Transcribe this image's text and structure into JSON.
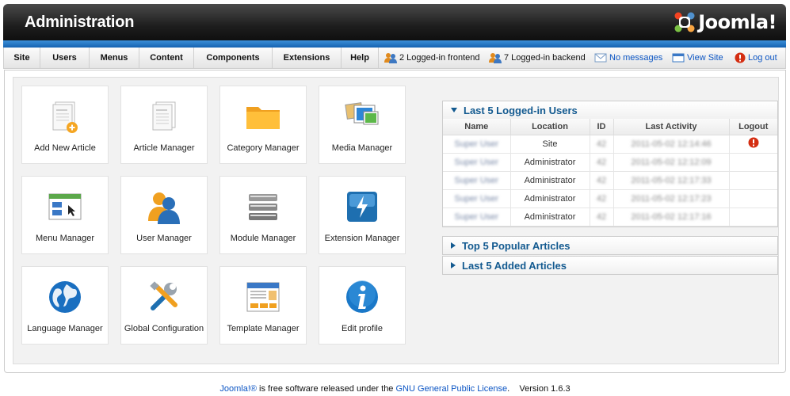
{
  "header": {
    "title": "Administration",
    "logo_text": "Joomla!"
  },
  "menu": {
    "items": [
      "Site",
      "Users",
      "Menus",
      "Content",
      "Components",
      "Extensions",
      "Help"
    ]
  },
  "status": {
    "frontend": "2 Logged-in frontend",
    "backend": "7 Logged-in backend",
    "messages": "No messages",
    "view_site": "View Site",
    "logout": "Log out"
  },
  "tiles": [
    {
      "label": "Add New Article",
      "icon": "add-article-icon"
    },
    {
      "label": "Article Manager",
      "icon": "article-manager-icon"
    },
    {
      "label": "Category Manager",
      "icon": "folder-icon"
    },
    {
      "label": "Media Manager",
      "icon": "media-icon"
    },
    {
      "label": "Menu Manager",
      "icon": "menu-manager-icon"
    },
    {
      "label": "User Manager",
      "icon": "users-icon"
    },
    {
      "label": "Module Manager",
      "icon": "module-icon"
    },
    {
      "label": "Extension Manager",
      "icon": "extension-icon"
    },
    {
      "label": "Language Manager",
      "icon": "globe-icon"
    },
    {
      "label": "Global Configuration",
      "icon": "tools-icon"
    },
    {
      "label": "Template Manager",
      "icon": "template-icon"
    },
    {
      "label": "Edit profile",
      "icon": "info-icon"
    }
  ],
  "logged_users": {
    "title": "Last 5 Logged-in Users",
    "columns": [
      "Name",
      "Location",
      "ID",
      "Last Activity",
      "Logout"
    ],
    "rows": [
      {
        "name": "Super User",
        "location": "Site",
        "id": "42",
        "activity": "2011-05-02 12:14:46",
        "logout": true
      },
      {
        "name": "Super User",
        "location": "Administrator",
        "id": "42",
        "activity": "2011-05-02 12:12:09",
        "logout": false
      },
      {
        "name": "Super User",
        "location": "Administrator",
        "id": "42",
        "activity": "2011-05-02 12:17:33",
        "logout": false
      },
      {
        "name": "Super User",
        "location": "Administrator",
        "id": "42",
        "activity": "2011-05-02 12:17:23",
        "logout": false
      },
      {
        "name": "Super User",
        "location": "Administrator",
        "id": "42",
        "activity": "2011-05-02 12:17:16",
        "logout": false
      }
    ]
  },
  "popular": {
    "title": "Top 5 Popular Articles"
  },
  "added": {
    "title": "Last 5 Added Articles"
  },
  "footer": {
    "joomla": "Joomla!®",
    "text1": " is free software released under the ",
    "license": "GNU General Public License",
    "text2": ".",
    "version": "Version 1.6.3"
  },
  "colors": {
    "accent": "#1563b2",
    "link": "#0b55c4",
    "heading": "#135a90"
  }
}
